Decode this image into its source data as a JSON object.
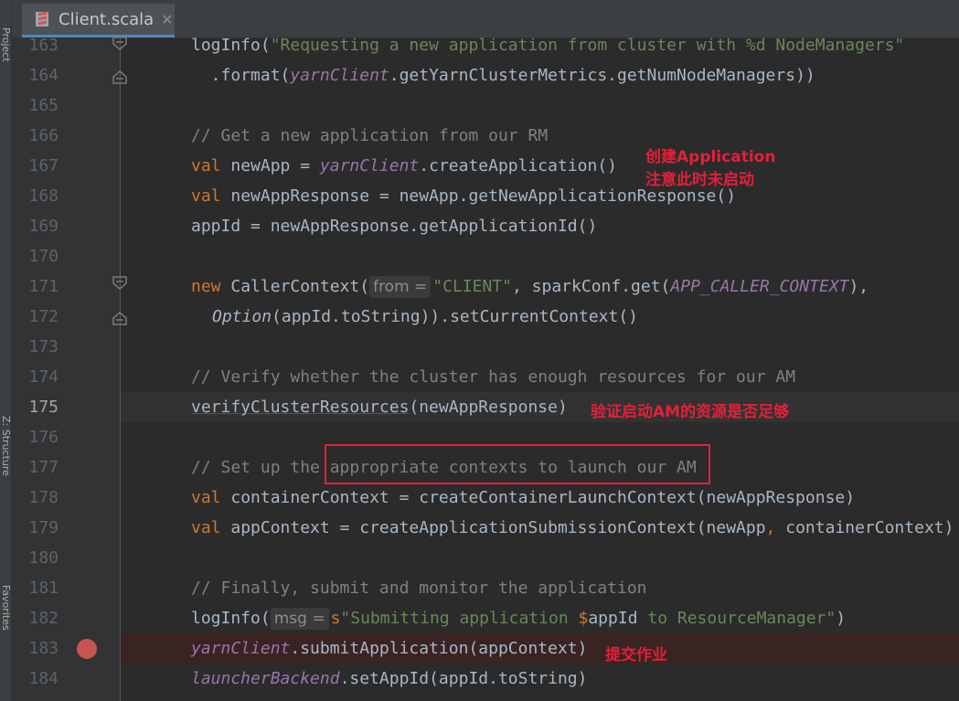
{
  "tab": {
    "name": "Client.scala",
    "close": "✕"
  },
  "side_labels": [
    "Project",
    "Z: Structure",
    "Favorites"
  ],
  "lines": [
    {
      "num": "163"
    },
    {
      "num": "164"
    },
    {
      "num": "165"
    },
    {
      "num": "166"
    },
    {
      "num": "167"
    },
    {
      "num": "168"
    },
    {
      "num": "169"
    },
    {
      "num": "170"
    },
    {
      "num": "171"
    },
    {
      "num": "172"
    },
    {
      "num": "173"
    },
    {
      "num": "174"
    },
    {
      "num": "175"
    },
    {
      "num": "176"
    },
    {
      "num": "177"
    },
    {
      "num": "178"
    },
    {
      "num": "179"
    },
    {
      "num": "180"
    },
    {
      "num": "181"
    },
    {
      "num": "182"
    },
    {
      "num": "183"
    },
    {
      "num": "184"
    }
  ],
  "code": {
    "l163": {
      "a": "logInfo(",
      "b": "\"Requesting a new application from cluster with %d NodeManagers\""
    },
    "l164": {
      "a": "  .format(",
      "b": "yarnClient",
      "c": ".getYarnClusterMetrics.getNumNodeManagers))"
    },
    "l166": {
      "a": "// Get a new application from our RM"
    },
    "l167": {
      "kw": "val",
      "a": " newApp = ",
      "b": "yarnClient",
      "c": ".createApplication()"
    },
    "l168": {
      "kw": "val",
      "a": " newAppResponse = newApp.getNewApplicationResponse()"
    },
    "l169": {
      "a": "appId = newAppResponse.getApplicationId()"
    },
    "l171": {
      "kw": "new",
      "a": " CallerContext(",
      "hint": "from =",
      "str": "\"CLIENT\"",
      "c": ", sparkConf.get(",
      "d": "APP_CALLER_CONTEXT",
      "e": "),"
    },
    "l172": {
      "a": "Option",
      "b": "(appId.toString)).setCurrentContext()"
    },
    "l174": {
      "a": "// Verify whether the cluster has enough resources for our AM"
    },
    "l175": {
      "a": "verifyClusterResources",
      "b": "(newAppResponse)"
    },
    "l177": {
      "a": "// Set up the appropriate contexts to launch our AM"
    },
    "l178": {
      "kw": "val",
      "a": " containerContext = createContainerLaunchContext(newAppResponse)"
    },
    "l179": {
      "kw": "val",
      "a": " appContext = createApplicationSubmissionContext(newApp",
      "b": ",",
      "c": " containerContext)"
    },
    "l181": {
      "a": "// Finally, submit and monitor the application"
    },
    "l182": {
      "a": "logInfo(",
      "hint": "msg =",
      "s": "s",
      "str1": "\"Submitting application ",
      "dollar": "$",
      "var": "appId",
      "str2": " to ResourceManager\"",
      "end": ")"
    },
    "l183": {
      "a": "yarnClient",
      "b": ".submitApplication(appContext)"
    },
    "l184": {
      "a": "launcherBackend",
      "b": ".setAppId(appId.toString)"
    }
  },
  "annotations": {
    "create_app": "创建Application",
    "not_started": "注意此时未启动",
    "verify_resources": "验证启动AM的资源是否足够",
    "submit_job": "提交作业"
  },
  "colors": {
    "background": "#2b2b2b",
    "keyword": "#cc7832",
    "string": "#6a8759",
    "comment": "#808080",
    "field": "#9876aa",
    "annotation": "#e2203a",
    "breakpoint": "#c75450"
  },
  "icons": {
    "tab": "scala-file-icon",
    "fold": "fold-marker-icon",
    "breakpoint": "breakpoint-icon"
  }
}
